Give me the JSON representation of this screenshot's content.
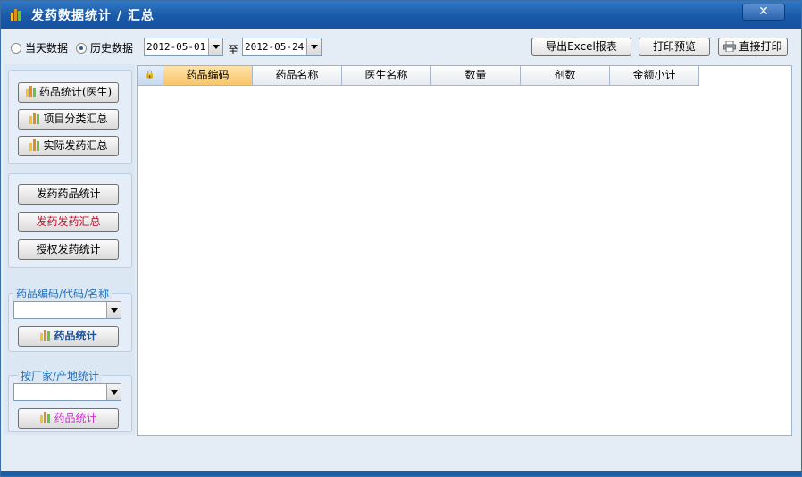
{
  "window": {
    "title": "发药数据统计 / 汇总",
    "close_label": "✕"
  },
  "toolbar": {
    "radio_today": "当天数据",
    "radio_history": "历史数据",
    "date_from": "2012-05-01",
    "to_label": "至",
    "date_to": "2012-05-24",
    "export_label": "导出Excel报表",
    "preview_label": "打印预览",
    "print_label": "直接打印"
  },
  "sidebar": {
    "group1": {
      "btn_drug_stats_doctor": "药品统计(医生)",
      "btn_item_category": "项目分类汇总",
      "btn_actual_dispense": "实际发药汇总"
    },
    "group2": {
      "btn_dispense_drug_stats": "发药药品统计",
      "btn_dispense_summary": "发药发药汇总",
      "btn_authorized_stats": "授权发药统计"
    },
    "group3": {
      "legend": "药品编码/代码/名称",
      "search_value": "",
      "btn_label": "药品统计"
    },
    "group4": {
      "legend": "按厂家/产地统计",
      "search_value": "",
      "btn_label": "药品统计"
    }
  },
  "grid": {
    "columns": [
      "药品编码",
      "药品名称",
      "医生名称",
      "数量",
      "剂数",
      "金额小计"
    ],
    "lock_glyph": "🔒"
  },
  "colors": {
    "title_bar": "#1959a8",
    "legend_text": "#1e6fbd",
    "summary_btn_text": "#c0102a",
    "drug_btn_bold": "#1a4f9a",
    "drug_btn_magenta": "#d030d0",
    "active_header": "#f8c56a"
  }
}
